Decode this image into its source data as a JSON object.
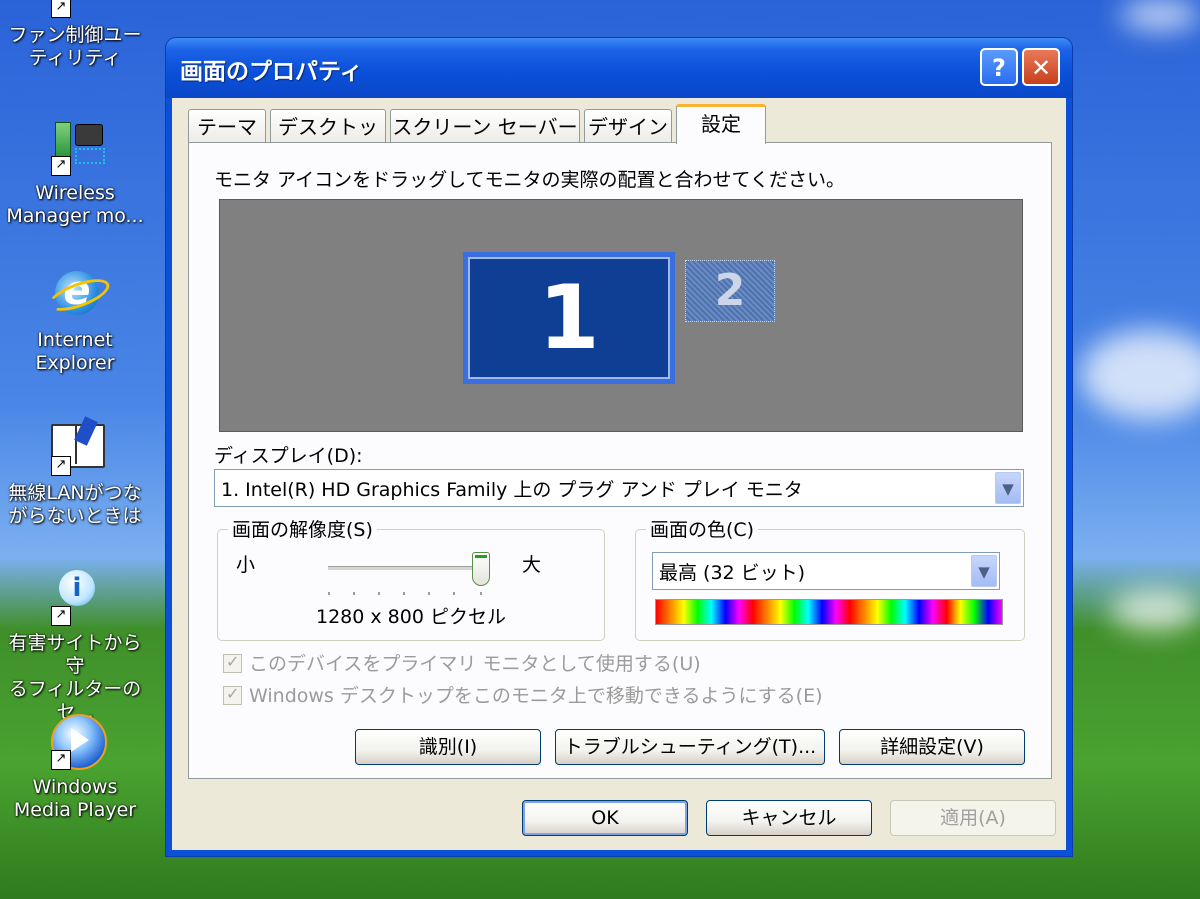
{
  "desktop": {
    "icons": [
      {
        "label": "ファン制御ユー\nティリティ",
        "icon": "fan-utility-icon"
      },
      {
        "label": "Wireless\nManager mo...",
        "icon": "wireless-manager-icon"
      },
      {
        "label": "Internet\nExplorer",
        "icon": "internet-explorer-icon"
      },
      {
        "label": "無線LANがつな\nがらないときは",
        "icon": "help-book-icon"
      },
      {
        "label": "有害サイトから守\nるフィルターのセ...",
        "icon": "info-icon"
      },
      {
        "label": "Windows\nMedia Player",
        "icon": "media-player-icon"
      }
    ],
    "shortcut_glyph": "↗"
  },
  "window": {
    "title": "画面のプロパティ",
    "help_glyph": "?",
    "close_glyph": "✕"
  },
  "tabs": [
    {
      "label": "テーマ"
    },
    {
      "label": "デスクトップ"
    },
    {
      "label": "スクリーン セーバー"
    },
    {
      "label": "デザイン"
    },
    {
      "label": "設定"
    }
  ],
  "settings": {
    "instruction": "モニタ アイコンをドラッグしてモニタの実際の配置と合わせてください。",
    "monitor1": "1",
    "monitor2": "2",
    "display_label": "ディスプレイ(D):",
    "display_value": "1. Intel(R) HD Graphics Family 上の プラグ アンド プレイ モニタ",
    "resolution": {
      "legend": "画面の解像度(S)",
      "min_label": "小",
      "max_label": "大",
      "value_text": "1280 x 800 ピクセル",
      "slider_position": 1.0
    },
    "color": {
      "legend": "画面の色(C)",
      "value": "最高 (32 ビット)"
    },
    "checkboxes": [
      {
        "label": "このデバイスをプライマリ モニタとして使用する(U)",
        "checked": true,
        "disabled": true
      },
      {
        "label": "Windows デスクトップをこのモニタ上で移動できるようにする(E)",
        "checked": true,
        "disabled": true
      }
    ],
    "buttons": {
      "identify": "識別(I)",
      "troubleshoot": "トラブルシューティング(T)...",
      "advanced": "詳細設定(V)"
    }
  },
  "footer": {
    "ok": "OK",
    "cancel": "キャンセル",
    "apply": "適用(A)"
  },
  "dropdown_glyph": "▼"
}
